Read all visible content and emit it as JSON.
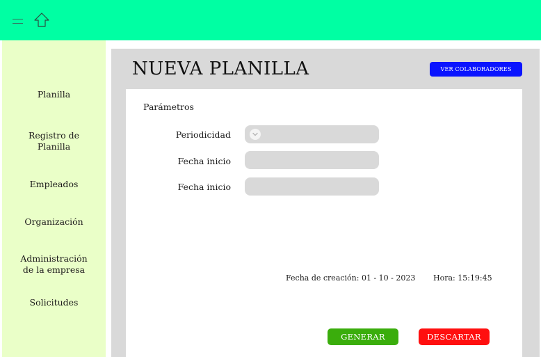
{
  "topbar": {
    "menu_icon": "hamburger-menu-icon",
    "home_icon": "home-icon",
    "bg_color": "#00ffa3"
  },
  "sidebar": {
    "bg_color": "#eaffc8",
    "items": [
      {
        "label": "Planilla"
      },
      {
        "label_line1": "Registro de",
        "label_line2": "Planilla"
      },
      {
        "label": "Empleados"
      },
      {
        "label": "Organización"
      },
      {
        "label_line1": "Administración",
        "label_line2": "de la empresa"
      },
      {
        "label": "Solicitudes"
      }
    ]
  },
  "main": {
    "title": "NUEVA PLANILLA",
    "view_button_label": "VER COLABORADORES",
    "section_label": "Parámetros",
    "fields": [
      {
        "label": "Periodicidad",
        "value": "",
        "type": "select",
        "icon": "chevron-down-icon"
      },
      {
        "label": "Fecha inicio",
        "value": ""
      },
      {
        "label": "Fecha inicio",
        "value": ""
      }
    ],
    "creation_date_label": "Fecha de creación: 01 - 10 - 2023",
    "time_label": "Hora: 15:19:45",
    "generate_label": "GENERAR",
    "discard_label": "DESCARTAR"
  },
  "colors": {
    "accent_blue": "#0a14ff",
    "generate_green": "#3aad0c",
    "discard_red": "#ff0f0f",
    "panel_gray": "#d9d9d9"
  }
}
